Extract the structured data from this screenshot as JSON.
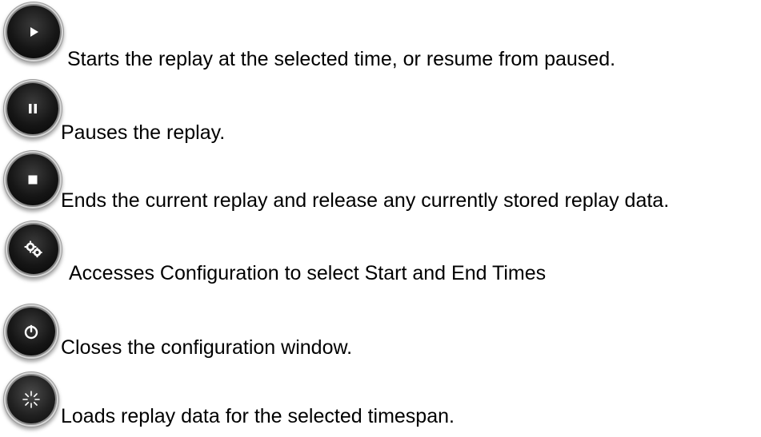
{
  "items": [
    {
      "icon": "play-icon",
      "description": "Starts the replay at the selected time, or resume from paused."
    },
    {
      "icon": "pause-icon",
      "description": "Pauses the replay."
    },
    {
      "icon": "stop-icon",
      "description": "Ends the current replay and release any currently stored replay data."
    },
    {
      "icon": "gears-icon",
      "description": "Accesses Configuration to select Start and End Times"
    },
    {
      "icon": "power-icon",
      "description": "Closes the configuration window."
    },
    {
      "icon": "loading-spinner-icon",
      "description": "Loads replay data for the selected timespan."
    }
  ]
}
